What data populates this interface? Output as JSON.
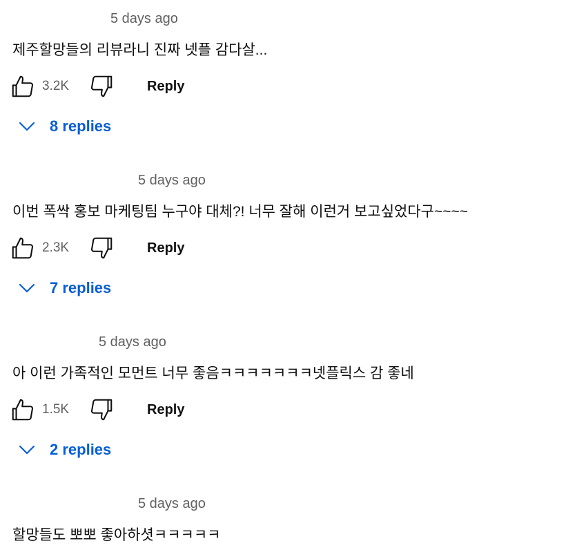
{
  "comments": [
    {
      "timestamp": "5 days ago",
      "text": "제주할망들의 리뷰라니 진짜 넷플 감다살...",
      "likes": "3.2K",
      "reply_label": "Reply",
      "replies_label": "8 replies"
    },
    {
      "timestamp": "5 days ago",
      "text": "이번 폭싹 홍보 마케팅팀 누구야 대체?! 너무 잘해 이런거 보고싶었다구~~~~",
      "likes": "2.3K",
      "reply_label": "Reply",
      "replies_label": "7 replies"
    },
    {
      "timestamp": "5 days ago",
      "text": "아 이런 가족적인 모먼트 너무 좋음ㅋㅋㅋㅋㅋㅋㅋ넷플릭스 감 좋네",
      "likes": "1.5K",
      "reply_label": "Reply",
      "replies_label": "2 replies"
    },
    {
      "timestamp": "5 days ago",
      "text": "할망들도 뽀뽀 좋아하셧ㅋㅋㅋㅋㅋ"
    }
  ],
  "icons": {
    "like": "thumbs-up-icon",
    "dislike": "thumbs-down-icon",
    "expand": "chevron-down-icon"
  },
  "colors": {
    "replies_link": "#065fd4",
    "secondary_text": "#606060",
    "primary_text": "#0f0f0f"
  }
}
